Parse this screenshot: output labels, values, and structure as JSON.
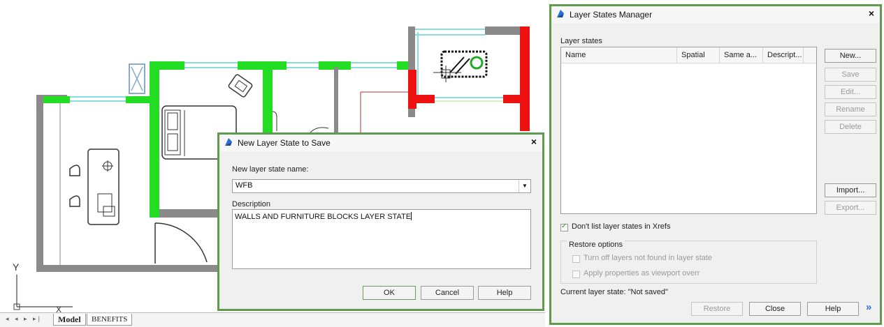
{
  "canvas": {
    "axis_y_label": "Y",
    "axis_x_label": "X"
  },
  "tabs": {
    "nav_glyphs": "◂ ◂ ▸ ▸|",
    "model": "Model",
    "benefits": "BENEFITS"
  },
  "new_state_dialog": {
    "title": "New Layer State to Save",
    "close": "×",
    "name_label": "New layer state name:",
    "name_value": "WFB",
    "description_label": "Description",
    "description_value": "WALLS AND FURNITURE BLOCKS LAYER STATE",
    "ok_label": "OK",
    "cancel_label": "Cancel",
    "help_label": "Help"
  },
  "layer_states_manager": {
    "title": "Layer States Manager",
    "close": "×",
    "layer_states_label": "Layer states",
    "columns": [
      "Name",
      "Spatial",
      "Same a...",
      "Descript..."
    ],
    "rows": [],
    "buttons": {
      "new": "New...",
      "save": "Save",
      "edit": "Edit...",
      "rename": "Rename",
      "delete": "Delete",
      "import": "Import...",
      "export": "Export..."
    },
    "dont_list_xrefs_label": "Don't list layer states in Xrefs",
    "dont_list_xrefs_checked": true,
    "restore_options_label": "Restore options",
    "turn_off_label": "Turn off layers not found in layer state",
    "apply_viewport_label": "Apply properties as viewport overr",
    "current_state_label": "Current layer state: \"Not saved\"",
    "restore_label": "Restore",
    "close_label": "Close",
    "help_label": "Help",
    "expand_glyph": "»"
  },
  "colors": {
    "wall_green": "#22dd22",
    "wall_red": "#ee1111",
    "wall_gray": "#8a8a8a",
    "dialog_border": "#5f9a4f",
    "window_cyan": "#88dddd"
  }
}
